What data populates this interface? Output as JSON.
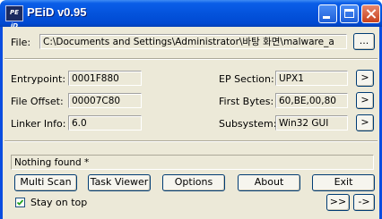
{
  "window": {
    "title": "PEiD v0.95",
    "icon_text": "PE iD"
  },
  "file": {
    "label": "File:",
    "path": "C:\\Documents and Settings\\Administrator\\바탕 화면\\malware_a",
    "browse_label": "..."
  },
  "info": {
    "entrypoint": {
      "label": "Entrypoint:",
      "value": "0001F880"
    },
    "file_offset": {
      "label": "File Offset:",
      "value": "00007C80"
    },
    "linker_info": {
      "label": "Linker Info:",
      "value": "6.0"
    },
    "ep_section": {
      "label": "EP Section:",
      "value": "UPX1"
    },
    "first_bytes": {
      "label": "First Bytes:",
      "value": "60,BE,00,80"
    },
    "subsystem": {
      "label": "Subsystem:",
      "value": "Win32 GUI"
    },
    "more_label": ">"
  },
  "status": {
    "text": "Nothing found *"
  },
  "buttons": {
    "multi_scan": "Multi Scan",
    "task_viewer": "Task Viewer",
    "options": "Options",
    "about": "About",
    "exit": "Exit"
  },
  "options": {
    "stay_on_top_label": "Stay on top",
    "stay_on_top_checked": true
  },
  "nav": {
    "next_label": ">>",
    "arrow_label": "->"
  }
}
